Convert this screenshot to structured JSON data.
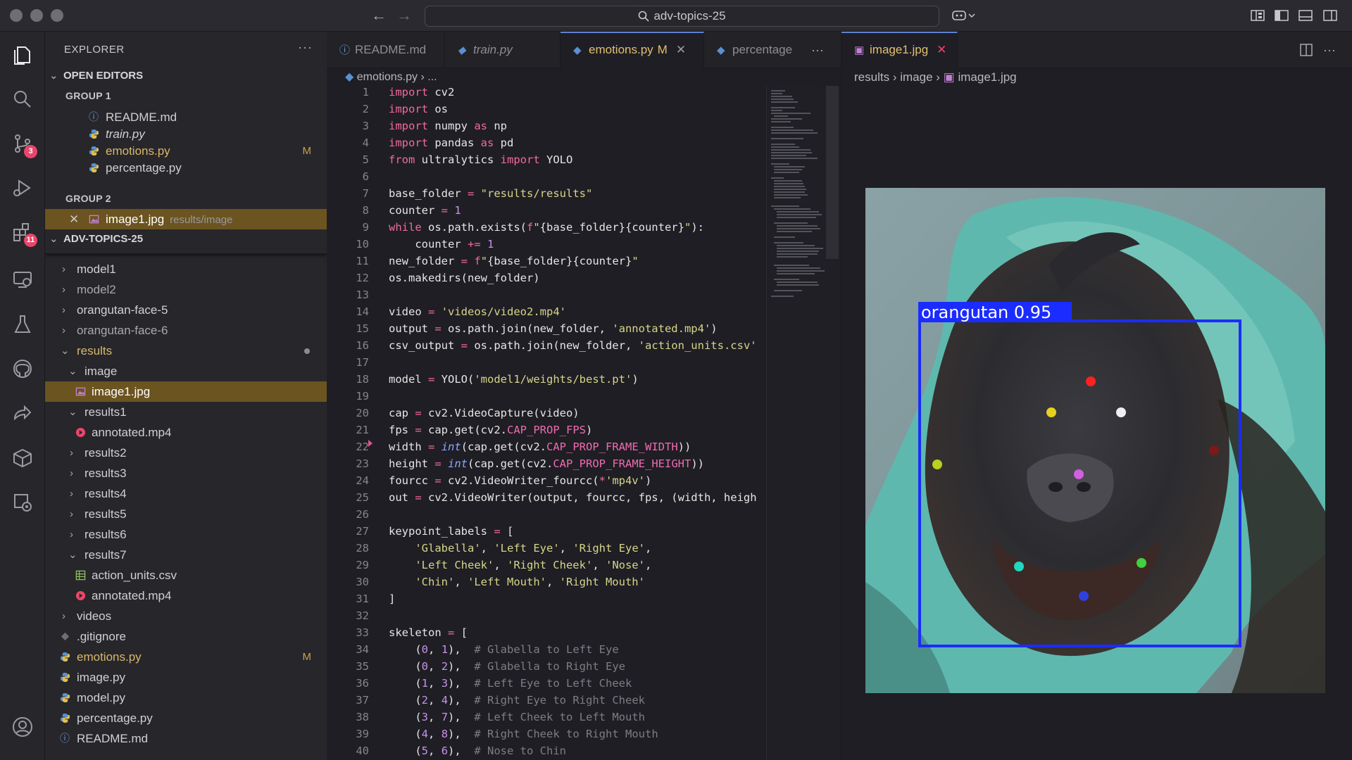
{
  "titlebar": {
    "search": "adv-topics-25"
  },
  "activity": {
    "scm_badge": "3",
    "extensions_badge": "11"
  },
  "sidebar": {
    "title": "EXPLORER",
    "open_editors_label": "OPEN EDITORS",
    "group1_label": "GROUP 1",
    "group2_label": "GROUP 2",
    "group1": [
      {
        "name": "README.md",
        "icon": "info-icon"
      },
      {
        "name": "train.py",
        "icon": "python-icon"
      },
      {
        "name": "emotions.py",
        "icon": "python-icon",
        "badge": "M"
      },
      {
        "name": "percentage.py",
        "icon": "python-icon"
      }
    ],
    "group2": [
      {
        "name": "image1.jpg",
        "path": "results/image",
        "icon": "image-icon"
      }
    ],
    "project_label": "ADV-TOPICS-25",
    "tree": [
      {
        "name": "model1"
      },
      {
        "name": "model2"
      },
      {
        "name": "orangutan-face-5"
      },
      {
        "name": "orangutan-face-6"
      },
      {
        "name": "results"
      },
      {
        "name": "image"
      },
      {
        "name": "image1.jpg"
      },
      {
        "name": "results1"
      },
      {
        "name": "annotated.mp4"
      },
      {
        "name": "results2"
      },
      {
        "name": "results3"
      },
      {
        "name": "results4"
      },
      {
        "name": "results5"
      },
      {
        "name": "results6"
      },
      {
        "name": "results7"
      },
      {
        "name": "action_units.csv"
      },
      {
        "name": "annotated.mp4"
      },
      {
        "name": "videos"
      },
      {
        "name": ".gitignore"
      },
      {
        "name": "emotions.py",
        "badge": "M"
      },
      {
        "name": "image.py"
      },
      {
        "name": "model.py"
      },
      {
        "name": "percentage.py"
      },
      {
        "name": "README.md"
      }
    ]
  },
  "editor1": {
    "tabs": [
      {
        "label": "README.md"
      },
      {
        "label": "train.py"
      },
      {
        "label": "emotions.py",
        "badge": "M"
      },
      {
        "label": "percentage"
      }
    ],
    "breadcrumb": [
      "emotions.py",
      "..."
    ]
  },
  "editor2": {
    "tab": "image1.jpg",
    "breadcrumb": [
      "results",
      "image",
      "image1.jpg"
    ],
    "detection_label": "orangutan 0.95"
  },
  "colors": {
    "accent": "#6080d0",
    "modified": "#e0c070",
    "selection": "#6b5420",
    "badge": "#e8466a",
    "bbox": "#1a2cff"
  }
}
